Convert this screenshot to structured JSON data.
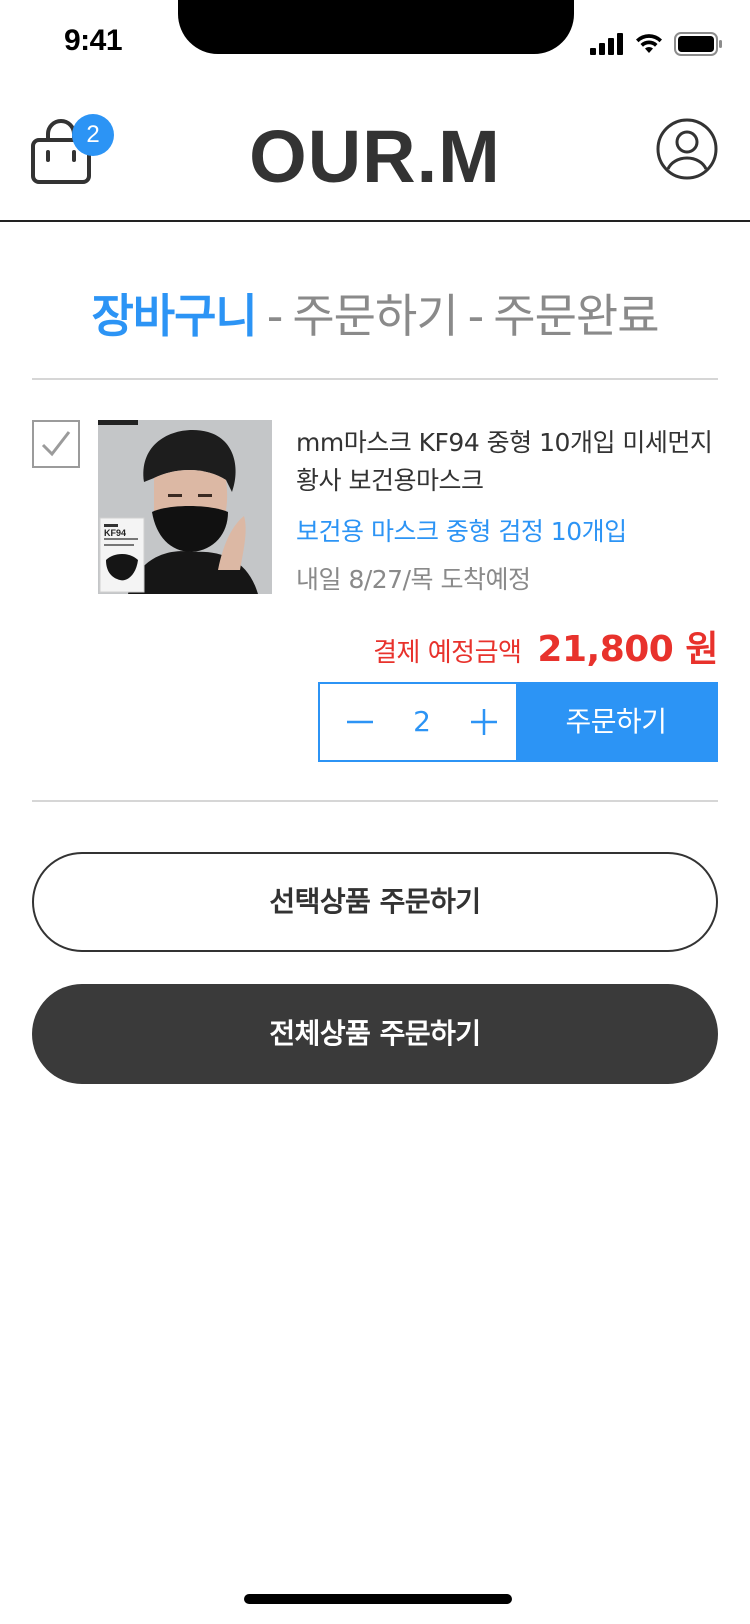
{
  "status_bar": {
    "time": "9:41"
  },
  "header": {
    "logo": "OUR.M",
    "cart_count": "2"
  },
  "steps": {
    "active": "장바구니",
    "separator": "-",
    "second": "주문하기",
    "third": "주문완료"
  },
  "item": {
    "name": "mm마스크 KF94 중형 10개입 미세먼지 황사 보건용마스크",
    "option": "보건용 마스크 중형 검정 10개입",
    "delivery": "내일 8/27/목 도착예정",
    "price_label": "결제 예정금액",
    "price_value": "21,800 원",
    "quantity": "2",
    "order_label": "주문하기",
    "checked": true,
    "packaging_text": "KF94"
  },
  "buttons": {
    "order_selected": "선택상품 주문하기",
    "order_all": "전체상품 주문하기"
  },
  "colors": {
    "accent": "#2c94f5",
    "price": "#e8322c",
    "dark": "#3a3a3a"
  },
  "icons": [
    "cart-icon",
    "account-icon",
    "check-icon",
    "minus-icon",
    "plus-icon",
    "signal-icon",
    "wifi-icon",
    "battery-icon"
  ]
}
